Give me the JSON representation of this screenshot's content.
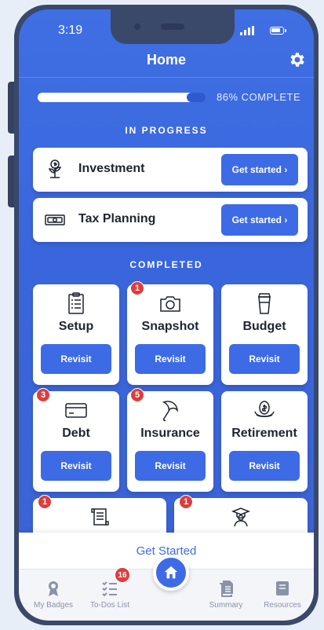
{
  "status": {
    "time": "3:19"
  },
  "header": {
    "title": "Home"
  },
  "progress": {
    "percent": 86,
    "label": "86% COMPLETE"
  },
  "in_progress": {
    "title": "IN PROGRESS",
    "items": [
      {
        "label": "Investment",
        "icon": "plant-money-icon",
        "button": "Get started ›"
      },
      {
        "label": "Tax Planning",
        "icon": "cash-icon",
        "button": "Get started ›"
      }
    ]
  },
  "completed": {
    "title": "COMPLETED",
    "tiles": [
      {
        "label": "Setup",
        "icon": "clipboard-icon",
        "button": "Revisit",
        "badge": null
      },
      {
        "label": "Snapshot",
        "icon": "camera-icon",
        "button": "Revisit",
        "badge": "1"
      },
      {
        "label": "Budget",
        "icon": "cup-icon",
        "button": "Revisit",
        "badge": null
      },
      {
        "label": "Debt",
        "icon": "credit-card-icon",
        "button": "Revisit",
        "badge": "3"
      },
      {
        "label": "Insurance",
        "icon": "umbrella-icon",
        "button": "Revisit",
        "badge": "5"
      },
      {
        "label": "Retirement",
        "icon": "nest-egg-icon",
        "button": "Revisit",
        "badge": null
      }
    ],
    "partial": [
      {
        "icon": "scroll-icon",
        "badge": "1"
      },
      {
        "icon": "graduate-icon",
        "badge": "1"
      }
    ]
  },
  "get_started_bar": {
    "label": "Get Started"
  },
  "tabbar": {
    "items": [
      {
        "label": "My Badges",
        "icon": "badge-icon"
      },
      {
        "label": "To-Dos List",
        "icon": "checklist-icon",
        "badge": "16"
      },
      {
        "label": "",
        "icon": "home-icon"
      },
      {
        "label": "Summary",
        "icon": "documents-icon"
      },
      {
        "label": "Resources",
        "icon": "book-icon"
      }
    ]
  },
  "colors": {
    "primary": "#3d6be6",
    "background": "#3f6fe3",
    "badge": "#e03c3c"
  }
}
